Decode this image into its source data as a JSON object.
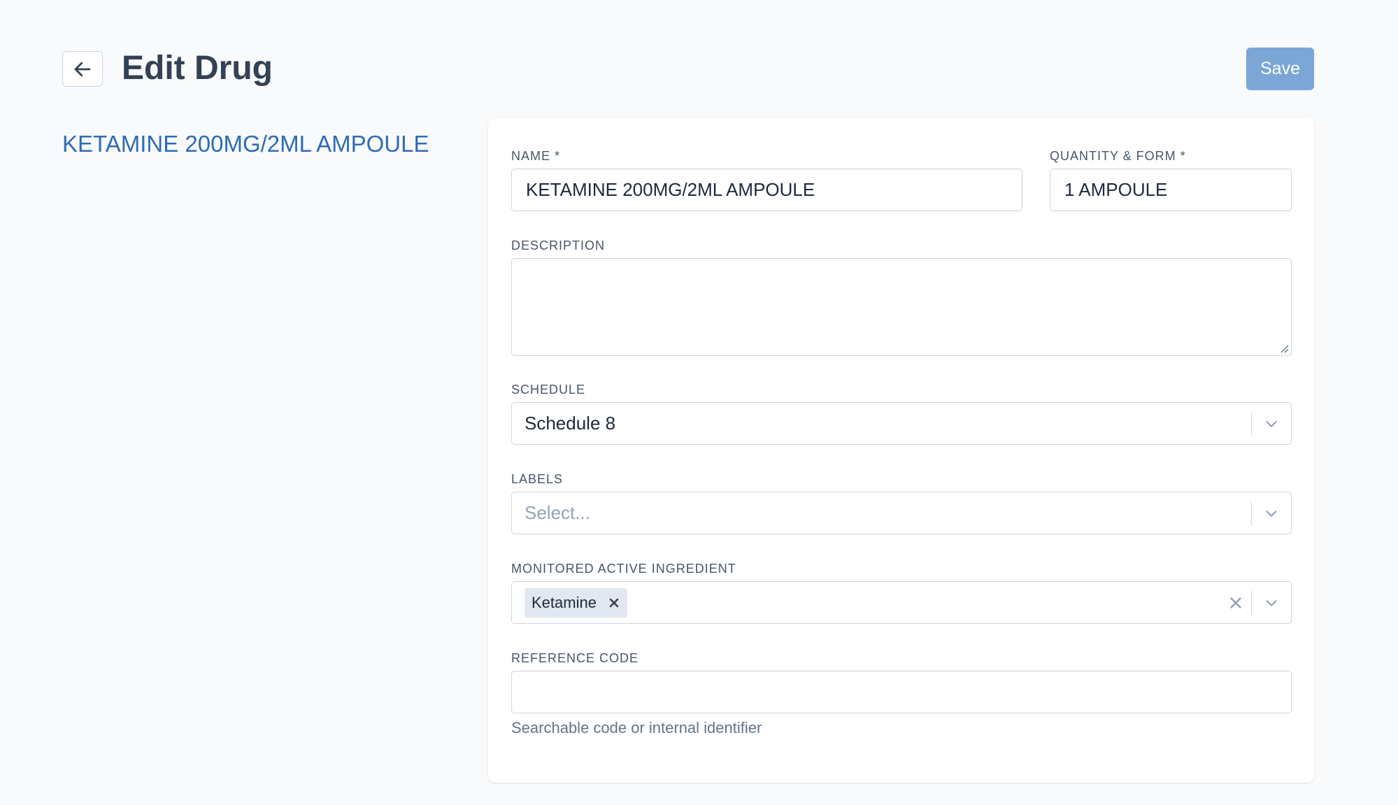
{
  "header": {
    "title": "Edit Drug",
    "save_label": "Save"
  },
  "drug_heading": "KETAMINE 200MG/2ML AMPOULE",
  "form": {
    "name": {
      "label": "NAME *",
      "value": "KETAMINE 200MG/2ML AMPOULE"
    },
    "quantity_form": {
      "label": "QUANTITY & FORM *",
      "value": "1 AMPOULE"
    },
    "description": {
      "label": "DESCRIPTION",
      "value": ""
    },
    "schedule": {
      "label": "SCHEDULE",
      "value": "Schedule 8"
    },
    "labels": {
      "label": "LABELS",
      "placeholder": "Select..."
    },
    "monitored_active_ingredient": {
      "label": "MONITORED ACTIVE INGREDIENT",
      "selected": [
        "Ketamine"
      ]
    },
    "reference_code": {
      "label": "REFERENCE CODE",
      "value": "",
      "help": "Searchable code or internal identifier"
    }
  },
  "colors": {
    "accent": "#2f6cb3",
    "save_button": "#7ba6d6",
    "background": "#f8fafc"
  },
  "icons": {
    "back": "arrow-left-icon",
    "chevron": "chevron-down-icon",
    "clear": "close-icon"
  }
}
